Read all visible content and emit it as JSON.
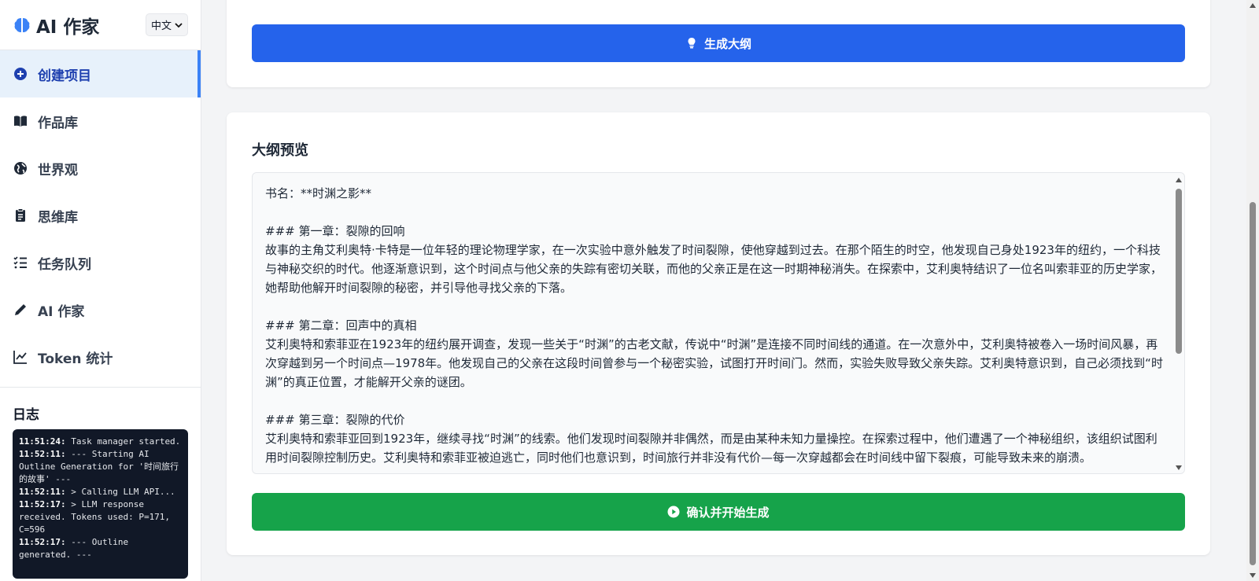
{
  "app": {
    "title": "AI 作家",
    "language": "中文"
  },
  "sidebar": {
    "items": [
      {
        "label": "创建项目",
        "icon": "plus-circle-icon"
      },
      {
        "label": "作品库",
        "icon": "book-open-icon"
      },
      {
        "label": "世界观",
        "icon": "globe-icon"
      },
      {
        "label": "思维库",
        "icon": "clipboard-icon"
      },
      {
        "label": "任务队列",
        "icon": "list-check-icon"
      },
      {
        "label": "AI 作家",
        "icon": "pen-icon"
      },
      {
        "label": "Token 统计",
        "icon": "line-chart-icon"
      }
    ],
    "active_index": 0
  },
  "log": {
    "title": "日志",
    "lines": [
      {
        "time": "11:51:24:",
        "text": " Task manager started."
      },
      {
        "time": "11:52:11:",
        "text": " --- Starting AI Outline Generation for '时间旅行的故事' ---"
      },
      {
        "time": "11:52:11:",
        "text": " > Calling LLM API..."
      },
      {
        "time": "11:52:17:",
        "text": " > LLM response received. Tokens used: P=171, C=596"
      },
      {
        "time": "11:52:17:",
        "text": " --- Outline generated. ---"
      }
    ]
  },
  "main": {
    "generate_button": "生成大纲",
    "preview_title": "大纲预览",
    "outline_text": "书名：**时渊之影**\n\n### 第一章：裂隙的回响\n故事的主角艾利奥特·卡特是一位年轻的理论物理学家，在一次实验中意外触发了时间裂隙，使他穿越到过去。在那个陌生的时空，他发现自己身处1923年的纽约，一个科技与神秘交织的时代。他逐渐意识到，这个时间点与他父亲的失踪有密切关联，而他的父亲正是在这一时期神秘消失。在探索中，艾利奥特结识了一位名叫索菲亚的历史学家，她帮助他解开时间裂隙的秘密，并引导他寻找父亲的下落。\n\n### 第二章：回声中的真相\n艾利奥特和索菲亚在1923年的纽约展开调查，发现一些关于“时渊”的古老文献，传说中“时渊”是连接不同时间线的通道。在一次意外中，艾利奥特被卷入一场时间风暴，再次穿越到另一个时间点—1978年。他发现自己的父亲在这段时间曾参与一个秘密实验，试图打开时间门。然而，实验失败导致父亲失踪。艾利奥特意识到，自己必须找到“时渊”的真正位置，才能解开父亲的谜团。\n\n### 第三章：裂隙的代价\n艾利奥特和索菲亚回到1923年，继续寻找“时渊”的线索。他们发现时间裂隙并非偶然，而是由某种未知力量操控。在探索过程中，他们遭遇了一个神秘组织，该组织试图利用时间裂隙控制历史。艾利奥特和索菲亚被迫逃亡，同时他们也意识到，时间旅行并非没有代价—每一次穿越都会在时间线中留下裂痕，可能导致未来的崩溃。",
    "confirm_button": "确认并开始生成"
  },
  "colors": {
    "primary": "#2563eb",
    "success": "#16a34a",
    "active_bg": "#e7f1fb",
    "log_bg": "#111827"
  }
}
